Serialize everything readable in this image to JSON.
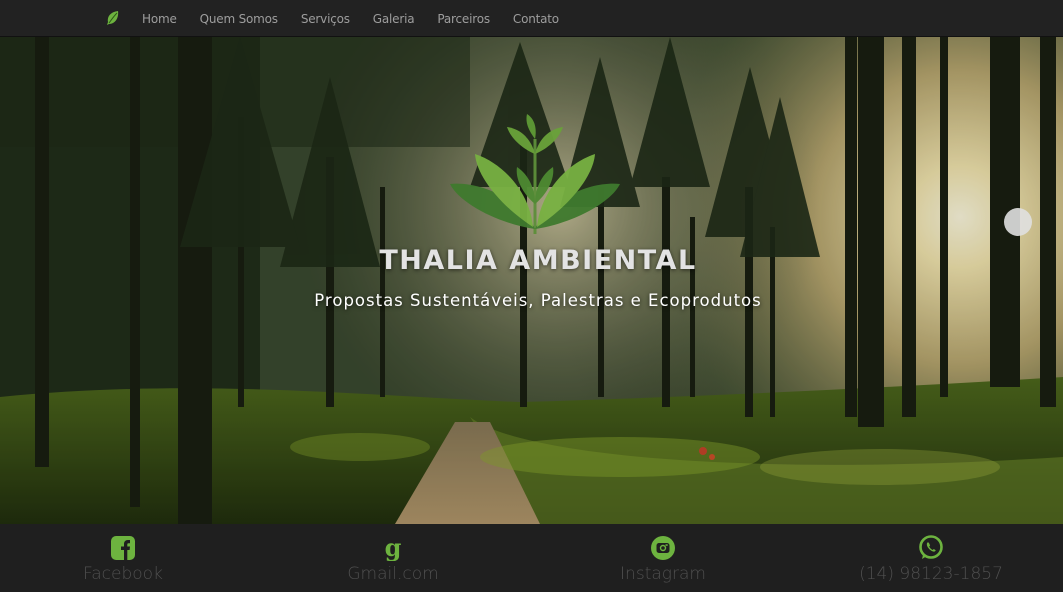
{
  "nav": {
    "brand_icon": "leaf-icon",
    "links": [
      "Home",
      "Quem Somos",
      "Serviços",
      "Galeria",
      "Parceiros",
      "Contato"
    ]
  },
  "hero": {
    "title": "THALIA AMBIENTAL",
    "subtitle": "Propostas Sustentáveis, Palestras e Ecoprodutos",
    "logo_icon": "plant-leaves-icon"
  },
  "footer": {
    "items": [
      {
        "icon": "facebook-icon",
        "label": "Facebook"
      },
      {
        "icon": "gmail-icon",
        "label": "Gmail.com"
      },
      {
        "icon": "instagram-icon",
        "label": "Instagram"
      },
      {
        "icon": "whatsapp-icon",
        "label": "(14) 98123-1857"
      }
    ]
  },
  "colors": {
    "accent_green": "#6db33f",
    "navbar_bg": "#222222",
    "footer_bg": "#1f1f1f"
  }
}
